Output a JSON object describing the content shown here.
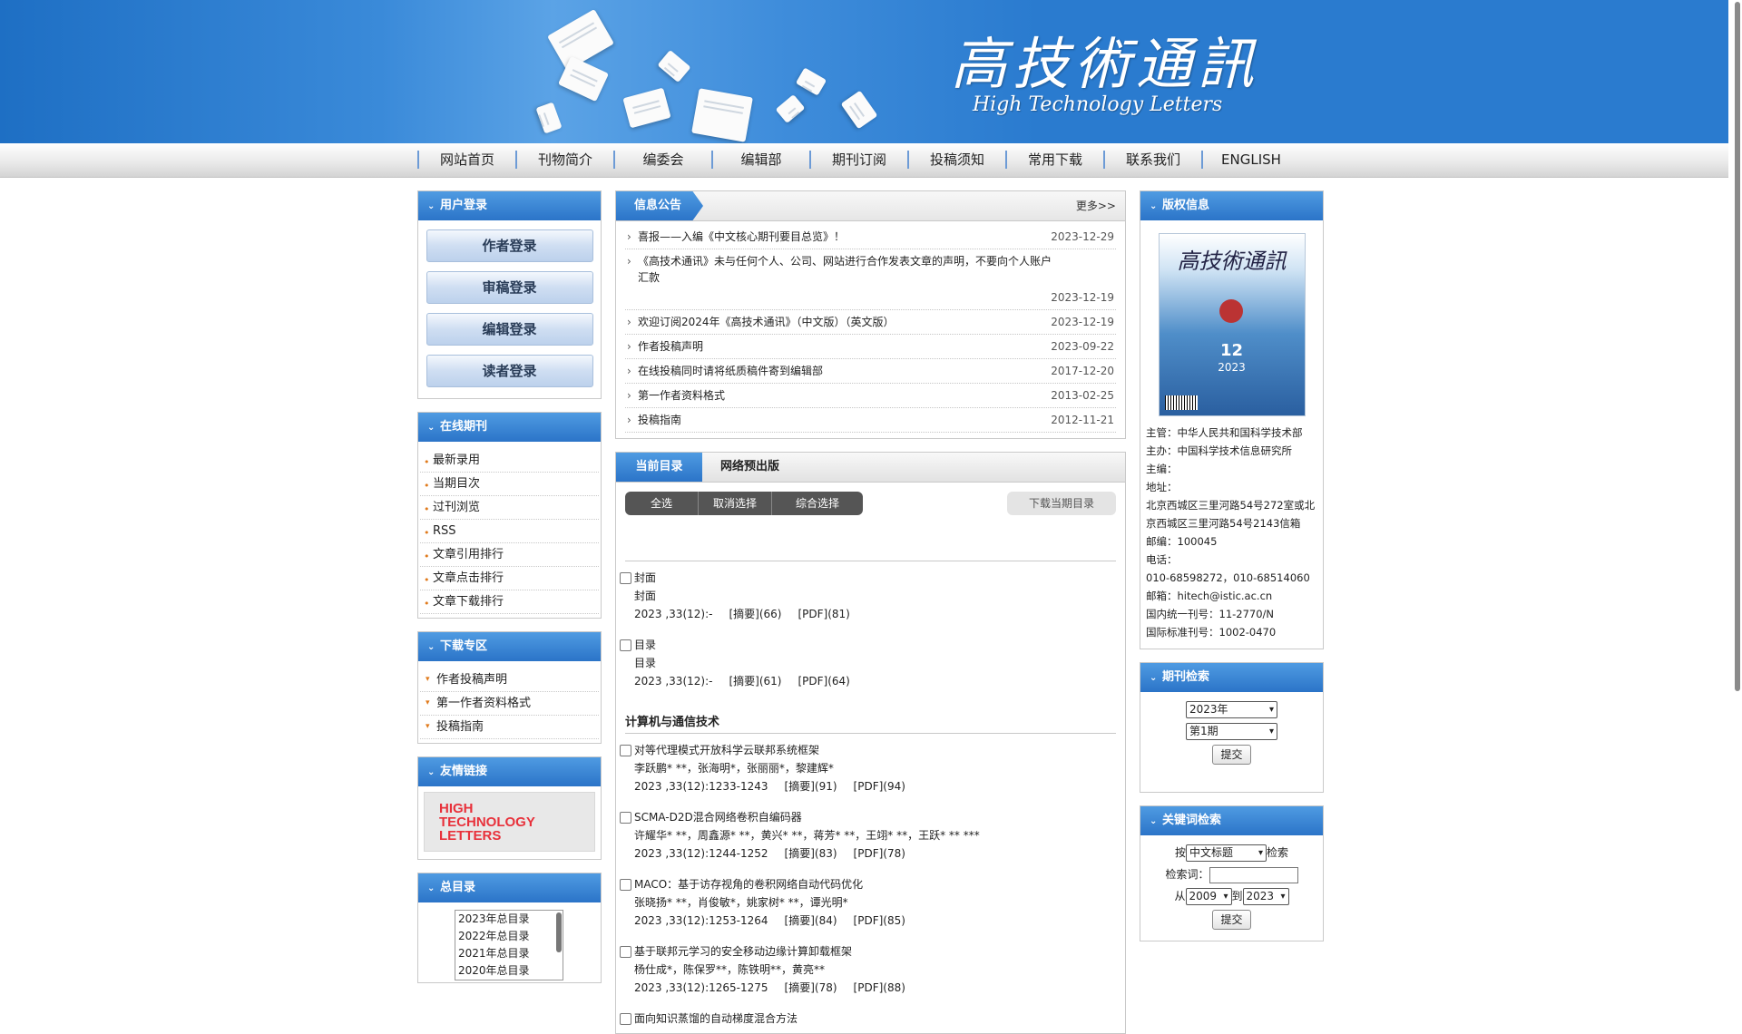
{
  "banner": {
    "logo_cn": "高技術通訊",
    "logo_en": "High Technology Letters"
  },
  "nav": [
    "网站首页",
    "刊物简介",
    "编委会",
    "编辑部",
    "期刊订阅",
    "投稿须知",
    "常用下载",
    "联系我们",
    "ENGLISH"
  ],
  "login": {
    "title": "用户登录",
    "buttons": [
      "作者登录",
      "审稿登录",
      "编辑登录",
      "读者登录"
    ]
  },
  "online": {
    "title": "在线期刊",
    "items": [
      "最新录用",
      "当期目次",
      "过刊浏览",
      "RSS",
      "文章引用排行",
      "文章点击排行",
      "文章下载排行"
    ]
  },
  "download": {
    "title": "下载专区",
    "items": [
      "作者投稿声明",
      "第一作者资料格式",
      "投稿指南"
    ]
  },
  "friends": {
    "title": "友情链接",
    "logo_text": "HIGH\nTECHNOLOGY\nLETTERS"
  },
  "archive": {
    "title": "总目录",
    "options": [
      "2023年总目录",
      "2022年总目录",
      "2021年总目录",
      "2020年总目录"
    ]
  },
  "notices": {
    "title": "信息公告",
    "more": "更多>>",
    "items": [
      {
        "text": "喜报——入编《中文核心期刊要目总览》！",
        "date": "2023-12-29"
      },
      {
        "text": "《高技术通讯》未与任何个人、公司、网站进行合作发表文章的声明，不要向个人账户汇款",
        "date": "2023-12-19"
      },
      {
        "text": "欢迎订阅2024年《高技术通讯》（中文版）（英文版）",
        "date": "2023-12-19"
      },
      {
        "text": "作者投稿声明",
        "date": "2023-09-22"
      },
      {
        "text": "在线投稿同时请将纸质稿件寄到编辑部",
        "date": "2017-12-20"
      },
      {
        "text": "第一作者资料格式",
        "date": "2013-02-25"
      },
      {
        "text": "投稿指南",
        "date": "2012-11-21"
      }
    ]
  },
  "toc": {
    "tab_current": "当前目录",
    "tab_online_first": "网络预出版",
    "btn_select_all": "全选",
    "btn_cancel": "取消选择",
    "btn_combined": "综合选择",
    "btn_download": "下载当期目录",
    "front": [
      {
        "title": "封面",
        "sub": "封面",
        "meta": "2023 ,33(12):-",
        "abs": "[摘要](66)",
        "pdf": "[PDF](81)"
      },
      {
        "title": "目录",
        "sub": "目录",
        "meta": "2023 ,33(12):-",
        "abs": "[摘要](61)",
        "pdf": "[PDF](64)"
      }
    ],
    "section": "计算机与通信技术",
    "articles": [
      {
        "title": "对等代理模式开放科学云联邦系统框架",
        "authors": "李跃鹏* **，张海明*，张丽丽*，黎建辉*",
        "meta": "2023 ,33(12):1233-1243",
        "abs": "[摘要](91)",
        "pdf": "[PDF](94)"
      },
      {
        "title": "SCMA-D2D混合网络卷积自编码器",
        "authors": "许耀华* **，周鑫源* **，黄兴* **，蒋芳* **，王翊* **，王跃* ** ***",
        "meta": "2023 ,33(12):1244-1252",
        "abs": "[摘要](83)",
        "pdf": "[PDF](78)"
      },
      {
        "title": "MACO：基于访存视角的卷积网络自动代码优化",
        "authors": "张晓扬* **，肖俊敏*，姚家树* **，谭光明*",
        "meta": "2023 ,33(12):1253-1264",
        "abs": "[摘要](84)",
        "pdf": "[PDF](85)"
      },
      {
        "title": "基于联邦元学习的安全移动边缘计算卸载框架",
        "authors": "杨仕成*，陈保罗**，陈铁明**，黄亮**",
        "meta": "2023 ,33(12):1265-1275",
        "abs": "[摘要](78)",
        "pdf": "[PDF](88)"
      }
    ],
    "last_title": "面向知识蒸馏的自动梯度混合方法"
  },
  "copyright": {
    "title": "版权信息",
    "cover_title": "高技術通訊",
    "cover_issue": "12",
    "cover_year": "2023",
    "rows": [
      {
        "k": "主管：",
        "v": "中华人民共和国科学技术部"
      },
      {
        "k": "主办：",
        "v": "中国科学技术信息研究所"
      },
      {
        "k": "主编：",
        "v": ""
      },
      {
        "k": "地址：",
        "v": ""
      }
    ],
    "address": "北京西城区三里河路54号272室或北京西城区三里河路54号2143信箱",
    "postcode_label": "邮编：",
    "postcode": "100045",
    "phone_label": "电话：",
    "phone": "010-68598272，010-68514060",
    "email_label": "邮箱：",
    "email": "hitech@istic.ac.cn",
    "cn_label": "国内统一刊号：",
    "cn": "11-2770/N",
    "issn_label": "国际标准刊号：",
    "issn": "1002-0470"
  },
  "issue_search": {
    "title": "期刊检索",
    "year": "2023年",
    "issue": "第1期",
    "submit": "提交"
  },
  "keyword_search": {
    "title": "关键词检索",
    "by_label": "按",
    "field": "中文标题",
    "search_label": "检索",
    "keyword_label": "检索词：",
    "from_label": "从",
    "from_year": "2009",
    "to_label": "到",
    "to_year": "2023",
    "submit": "提交"
  }
}
